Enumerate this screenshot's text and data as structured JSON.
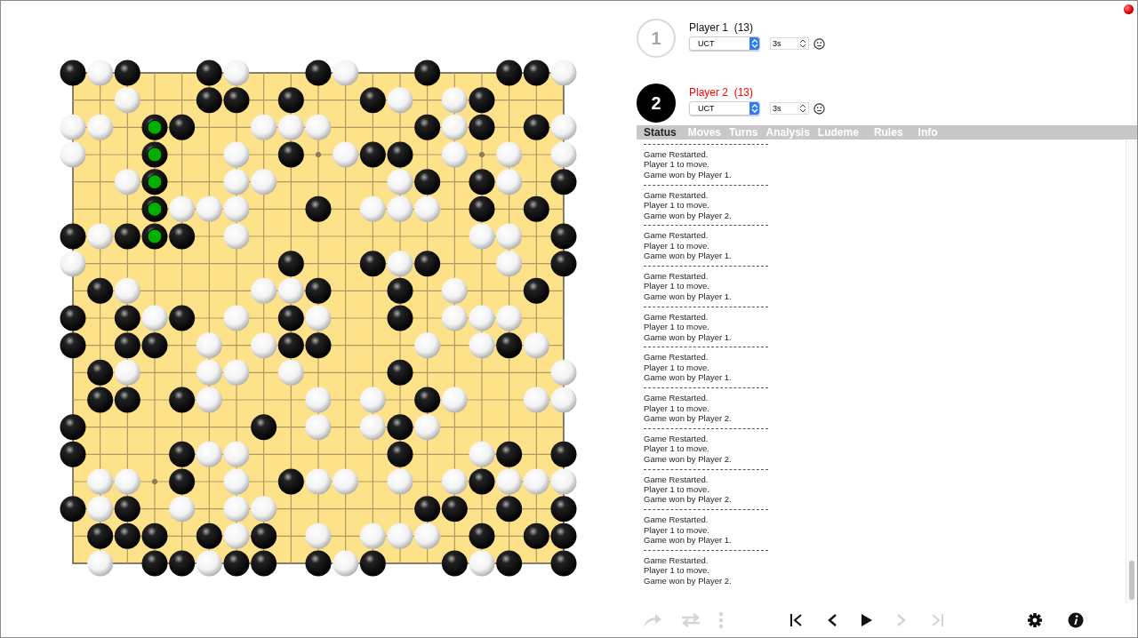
{
  "board": {
    "rows": [
      {
        "points": [
          {
            "kind": "black"
          },
          {
            "kind": "white"
          },
          {
            "kind": "black"
          },
          {
            "kind": "empty"
          },
          {
            "kind": "empty"
          },
          {
            "kind": "black"
          },
          {
            "kind": "white"
          },
          {
            "kind": "empty"
          },
          {
            "kind": "empty"
          },
          {
            "kind": "black"
          },
          {
            "kind": "white"
          },
          {
            "kind": "empty"
          },
          {
            "kind": "empty"
          },
          {
            "kind": "black"
          },
          {
            "kind": "empty"
          },
          {
            "kind": "empty"
          },
          {
            "kind": "black"
          },
          {
            "kind": "black"
          },
          {
            "kind": "white"
          }
        ]
      },
      {
        "points": [
          {
            "kind": "empty"
          },
          {
            "kind": "empty"
          },
          {
            "kind": "white"
          },
          {
            "kind": "empty"
          },
          {
            "kind": "empty"
          },
          {
            "kind": "black"
          },
          {
            "kind": "black"
          },
          {
            "kind": "empty"
          },
          {
            "kind": "black"
          },
          {
            "kind": "empty"
          },
          {
            "kind": "empty"
          },
          {
            "kind": "black"
          },
          {
            "kind": "white"
          },
          {
            "kind": "empty"
          },
          {
            "kind": "white"
          },
          {
            "kind": "black"
          },
          {
            "kind": "empty"
          },
          {
            "kind": "empty"
          },
          {
            "kind": "empty"
          }
        ]
      },
      {
        "points": [
          {
            "kind": "white"
          },
          {
            "kind": "white"
          },
          {
            "kind": "empty"
          },
          {
            "kind": "marked"
          },
          {
            "kind": "black"
          },
          {
            "kind": "empty"
          },
          {
            "kind": "empty"
          },
          {
            "kind": "white"
          },
          {
            "kind": "white"
          },
          {
            "kind": "white"
          },
          {
            "kind": "empty"
          },
          {
            "kind": "empty"
          },
          {
            "kind": "empty"
          },
          {
            "kind": "black"
          },
          {
            "kind": "white"
          },
          {
            "kind": "black"
          },
          {
            "kind": "empty"
          },
          {
            "kind": "black"
          },
          {
            "kind": "white"
          }
        ]
      },
      {
        "points": [
          {
            "kind": "white"
          },
          {
            "kind": "empty"
          },
          {
            "kind": "empty"
          },
          {
            "kind": "marked"
          },
          {
            "kind": "empty"
          },
          {
            "kind": "empty"
          },
          {
            "kind": "white"
          },
          {
            "kind": "empty"
          },
          {
            "kind": "black"
          },
          {
            "kind": "empty"
          },
          {
            "kind": "white"
          },
          {
            "kind": "black"
          },
          {
            "kind": "black"
          },
          {
            "kind": "empty"
          },
          {
            "kind": "white"
          },
          {
            "kind": "empty"
          },
          {
            "kind": "white"
          },
          {
            "kind": "empty"
          },
          {
            "kind": "white"
          }
        ]
      },
      {
        "points": [
          {
            "kind": "empty"
          },
          {
            "kind": "empty"
          },
          {
            "kind": "white"
          },
          {
            "kind": "marked"
          },
          {
            "kind": "empty"
          },
          {
            "kind": "empty"
          },
          {
            "kind": "white"
          },
          {
            "kind": "white"
          },
          {
            "kind": "empty"
          },
          {
            "kind": "empty"
          },
          {
            "kind": "empty"
          },
          {
            "kind": "empty"
          },
          {
            "kind": "white"
          },
          {
            "kind": "black"
          },
          {
            "kind": "empty"
          },
          {
            "kind": "black"
          },
          {
            "kind": "white"
          },
          {
            "kind": "empty"
          },
          {
            "kind": "black"
          }
        ]
      },
      {
        "points": [
          {
            "kind": "empty"
          },
          {
            "kind": "empty"
          },
          {
            "kind": "empty"
          },
          {
            "kind": "marked"
          },
          {
            "kind": "white"
          },
          {
            "kind": "white"
          },
          {
            "kind": "white"
          },
          {
            "kind": "empty"
          },
          {
            "kind": "empty"
          },
          {
            "kind": "black"
          },
          {
            "kind": "empty"
          },
          {
            "kind": "white"
          },
          {
            "kind": "white"
          },
          {
            "kind": "white"
          },
          {
            "kind": "empty"
          },
          {
            "kind": "black"
          },
          {
            "kind": "empty"
          },
          {
            "kind": "black"
          },
          {
            "kind": "empty"
          }
        ]
      },
      {
        "points": [
          {
            "kind": "black"
          },
          {
            "kind": "white"
          },
          {
            "kind": "black"
          },
          {
            "kind": "marked"
          },
          {
            "kind": "black"
          },
          {
            "kind": "empty"
          },
          {
            "kind": "white"
          },
          {
            "kind": "empty"
          },
          {
            "kind": "empty"
          },
          {
            "kind": "empty"
          },
          {
            "kind": "empty"
          },
          {
            "kind": "empty"
          },
          {
            "kind": "empty"
          },
          {
            "kind": "empty"
          },
          {
            "kind": "empty"
          },
          {
            "kind": "white"
          },
          {
            "kind": "white"
          },
          {
            "kind": "empty"
          },
          {
            "kind": "black"
          }
        ]
      },
      {
        "points": [
          {
            "kind": "white"
          },
          {
            "kind": "empty"
          },
          {
            "kind": "empty"
          },
          {
            "kind": "empty"
          },
          {
            "kind": "empty"
          },
          {
            "kind": "empty"
          },
          {
            "kind": "empty"
          },
          {
            "kind": "empty"
          },
          {
            "kind": "black"
          },
          {
            "kind": "empty"
          },
          {
            "kind": "empty"
          },
          {
            "kind": "black"
          },
          {
            "kind": "white"
          },
          {
            "kind": "black"
          },
          {
            "kind": "empty"
          },
          {
            "kind": "empty"
          },
          {
            "kind": "white"
          },
          {
            "kind": "empty"
          },
          {
            "kind": "black"
          }
        ]
      },
      {
        "points": [
          {
            "kind": "empty"
          },
          {
            "kind": "black"
          },
          {
            "kind": "white"
          },
          {
            "kind": "empty"
          },
          {
            "kind": "empty"
          },
          {
            "kind": "empty"
          },
          {
            "kind": "empty"
          },
          {
            "kind": "white"
          },
          {
            "kind": "white"
          },
          {
            "kind": "black"
          },
          {
            "kind": "empty"
          },
          {
            "kind": "empty"
          },
          {
            "kind": "black"
          },
          {
            "kind": "empty"
          },
          {
            "kind": "white"
          },
          {
            "kind": "empty"
          },
          {
            "kind": "empty"
          },
          {
            "kind": "black"
          },
          {
            "kind": "empty"
          }
        ]
      },
      {
        "points": [
          {
            "kind": "black"
          },
          {
            "kind": "empty"
          },
          {
            "kind": "black"
          },
          {
            "kind": "white"
          },
          {
            "kind": "black"
          },
          {
            "kind": "empty"
          },
          {
            "kind": "white"
          },
          {
            "kind": "empty"
          },
          {
            "kind": "black"
          },
          {
            "kind": "white"
          },
          {
            "kind": "empty"
          },
          {
            "kind": "empty"
          },
          {
            "kind": "black"
          },
          {
            "kind": "empty"
          },
          {
            "kind": "white"
          },
          {
            "kind": "white"
          },
          {
            "kind": "white"
          },
          {
            "kind": "empty"
          },
          {
            "kind": "empty"
          }
        ]
      },
      {
        "points": [
          {
            "kind": "black"
          },
          {
            "kind": "empty"
          },
          {
            "kind": "black"
          },
          {
            "kind": "black"
          },
          {
            "kind": "empty"
          },
          {
            "kind": "white"
          },
          {
            "kind": "empty"
          },
          {
            "kind": "white"
          },
          {
            "kind": "black"
          },
          {
            "kind": "black"
          },
          {
            "kind": "empty"
          },
          {
            "kind": "empty"
          },
          {
            "kind": "empty"
          },
          {
            "kind": "white"
          },
          {
            "kind": "empty"
          },
          {
            "kind": "white"
          },
          {
            "kind": "black"
          },
          {
            "kind": "white"
          },
          {
            "kind": "empty"
          }
        ]
      },
      {
        "points": [
          {
            "kind": "empty"
          },
          {
            "kind": "black"
          },
          {
            "kind": "white"
          },
          {
            "kind": "empty"
          },
          {
            "kind": "empty"
          },
          {
            "kind": "white"
          },
          {
            "kind": "white"
          },
          {
            "kind": "empty"
          },
          {
            "kind": "white"
          },
          {
            "kind": "empty"
          },
          {
            "kind": "empty"
          },
          {
            "kind": "empty"
          },
          {
            "kind": "black"
          },
          {
            "kind": "empty"
          },
          {
            "kind": "empty"
          },
          {
            "kind": "empty"
          },
          {
            "kind": "empty"
          },
          {
            "kind": "empty"
          },
          {
            "kind": "white"
          }
        ]
      },
      {
        "points": [
          {
            "kind": "empty"
          },
          {
            "kind": "black"
          },
          {
            "kind": "black"
          },
          {
            "kind": "empty"
          },
          {
            "kind": "black"
          },
          {
            "kind": "white"
          },
          {
            "kind": "empty"
          },
          {
            "kind": "empty"
          },
          {
            "kind": "empty"
          },
          {
            "kind": "white"
          },
          {
            "kind": "empty"
          },
          {
            "kind": "white"
          },
          {
            "kind": "empty"
          },
          {
            "kind": "black"
          },
          {
            "kind": "white"
          },
          {
            "kind": "empty"
          },
          {
            "kind": "empty"
          },
          {
            "kind": "white"
          },
          {
            "kind": "white"
          }
        ]
      },
      {
        "points": [
          {
            "kind": "black"
          },
          {
            "kind": "empty"
          },
          {
            "kind": "empty"
          },
          {
            "kind": "empty"
          },
          {
            "kind": "empty"
          },
          {
            "kind": "empty"
          },
          {
            "kind": "empty"
          },
          {
            "kind": "black"
          },
          {
            "kind": "empty"
          },
          {
            "kind": "white"
          },
          {
            "kind": "empty"
          },
          {
            "kind": "white"
          },
          {
            "kind": "black"
          },
          {
            "kind": "white"
          },
          {
            "kind": "empty"
          },
          {
            "kind": "empty"
          },
          {
            "kind": "empty"
          },
          {
            "kind": "empty"
          },
          {
            "kind": "empty"
          }
        ]
      },
      {
        "points": [
          {
            "kind": "black"
          },
          {
            "kind": "empty"
          },
          {
            "kind": "empty"
          },
          {
            "kind": "empty"
          },
          {
            "kind": "black"
          },
          {
            "kind": "white"
          },
          {
            "kind": "white"
          },
          {
            "kind": "empty"
          },
          {
            "kind": "empty"
          },
          {
            "kind": "empty"
          },
          {
            "kind": "empty"
          },
          {
            "kind": "empty"
          },
          {
            "kind": "black"
          },
          {
            "kind": "empty"
          },
          {
            "kind": "empty"
          },
          {
            "kind": "white"
          },
          {
            "kind": "black"
          },
          {
            "kind": "empty"
          },
          {
            "kind": "black"
          }
        ]
      },
      {
        "points": [
          {
            "kind": "empty"
          },
          {
            "kind": "white"
          },
          {
            "kind": "white"
          },
          {
            "kind": "empty"
          },
          {
            "kind": "black"
          },
          {
            "kind": "empty"
          },
          {
            "kind": "white"
          },
          {
            "kind": "empty"
          },
          {
            "kind": "black"
          },
          {
            "kind": "white"
          },
          {
            "kind": "white"
          },
          {
            "kind": "empty"
          },
          {
            "kind": "white"
          },
          {
            "kind": "empty"
          },
          {
            "kind": "white"
          },
          {
            "kind": "black"
          },
          {
            "kind": "white"
          },
          {
            "kind": "white"
          },
          {
            "kind": "white"
          }
        ]
      },
      {
        "points": [
          {
            "kind": "black"
          },
          {
            "kind": "white"
          },
          {
            "kind": "black"
          },
          {
            "kind": "empty"
          },
          {
            "kind": "white"
          },
          {
            "kind": "empty"
          },
          {
            "kind": "white"
          },
          {
            "kind": "white"
          },
          {
            "kind": "empty"
          },
          {
            "kind": "empty"
          },
          {
            "kind": "empty"
          },
          {
            "kind": "empty"
          },
          {
            "kind": "empty"
          },
          {
            "kind": "black"
          },
          {
            "kind": "black"
          },
          {
            "kind": "empty"
          },
          {
            "kind": "black"
          },
          {
            "kind": "empty"
          },
          {
            "kind": "black"
          }
        ]
      },
      {
        "points": [
          {
            "kind": "empty"
          },
          {
            "kind": "black"
          },
          {
            "kind": "black"
          },
          {
            "kind": "black"
          },
          {
            "kind": "empty"
          },
          {
            "kind": "black"
          },
          {
            "kind": "white"
          },
          {
            "kind": "black"
          },
          {
            "kind": "empty"
          },
          {
            "kind": "white"
          },
          {
            "kind": "empty"
          },
          {
            "kind": "white"
          },
          {
            "kind": "white"
          },
          {
            "kind": "white"
          },
          {
            "kind": "empty"
          },
          {
            "kind": "black"
          },
          {
            "kind": "empty"
          },
          {
            "kind": "black"
          },
          {
            "kind": "black"
          }
        ]
      },
      {
        "points": [
          {
            "kind": "empty"
          },
          {
            "kind": "white"
          },
          {
            "kind": "empty"
          },
          {
            "kind": "black"
          },
          {
            "kind": "black"
          },
          {
            "kind": "white"
          },
          {
            "kind": "black"
          },
          {
            "kind": "black"
          },
          {
            "kind": "empty"
          },
          {
            "kind": "black"
          },
          {
            "kind": "white"
          },
          {
            "kind": "black"
          },
          {
            "kind": "empty"
          },
          {
            "kind": "empty"
          },
          {
            "kind": "black"
          },
          {
            "kind": "white"
          },
          {
            "kind": "black"
          },
          {
            "kind": "empty"
          },
          {
            "kind": "black"
          }
        ]
      }
    ]
  },
  "players": [
    {
      "number": "1",
      "name": "Player 1  (13)",
      "to_move": false,
      "agent": "UCT",
      "time": "3s"
    },
    {
      "number": "2",
      "name": "Player 2  (13)",
      "to_move": true,
      "agent": "UCT",
      "time": "3s"
    }
  ],
  "tabs": [
    {
      "label": "Status",
      "selected": true
    },
    {
      "label": "Moves",
      "selected": false
    },
    {
      "label": "Turns",
      "selected": false
    },
    {
      "label": "Analysis",
      "selected": false
    },
    {
      "label": "Ludeme",
      "selected": false
    },
    {
      "label": "Rules",
      "selected": false
    },
    {
      "label": "Info",
      "selected": false
    }
  ],
  "status_log": [
    {
      "lines": [
        "Game Restarted.",
        "Player 1 to move.",
        "Game won by Player 1."
      ]
    },
    {
      "lines": [
        "Game Restarted.",
        "Player 1 to move.",
        "Game won by Player 2."
      ]
    },
    {
      "lines": [
        "Game Restarted.",
        "Player 1 to move.",
        "Game won by Player 1."
      ]
    },
    {
      "lines": [
        "Game Restarted.",
        "Player 1 to move.",
        "Game won by Player 1."
      ]
    },
    {
      "lines": [
        "Game Restarted.",
        "Player 1 to move.",
        "Game won by Player 1."
      ]
    },
    {
      "lines": [
        "Game Restarted.",
        "Player 1 to move.",
        "Game won by Player 1."
      ]
    },
    {
      "lines": [
        "Game Restarted.",
        "Player 1 to move.",
        "Game won by Player 2."
      ]
    },
    {
      "lines": [
        "Game Restarted.",
        "Player 1 to move.",
        "Game won by Player 2."
      ]
    },
    {
      "lines": [
        "Game Restarted.",
        "Player 1 to move.",
        "Game won by Player 2."
      ]
    },
    {
      "lines": [
        "Game Restarted.",
        "Player 1 to move.",
        "Game won by Player 1."
      ]
    },
    {
      "lines": [
        "Game Restarted.",
        "Player 1 to move.",
        "Game won by Player 2."
      ]
    }
  ],
  "toolbar": {
    "left": [
      {
        "kind": "redo",
        "disabled": true
      },
      {
        "kind": "swap",
        "disabled": true
      },
      {
        "kind": "more",
        "disabled": true
      }
    ],
    "center": [
      {
        "kind": "first",
        "disabled": false
      },
      {
        "kind": "prev",
        "disabled": false
      },
      {
        "kind": "play",
        "disabled": false
      },
      {
        "kind": "next",
        "disabled": true
      },
      {
        "kind": "last",
        "disabled": true
      }
    ],
    "right": [
      {
        "kind": "settings",
        "disabled": false
      },
      {
        "kind": "info",
        "disabled": false
      }
    ]
  }
}
